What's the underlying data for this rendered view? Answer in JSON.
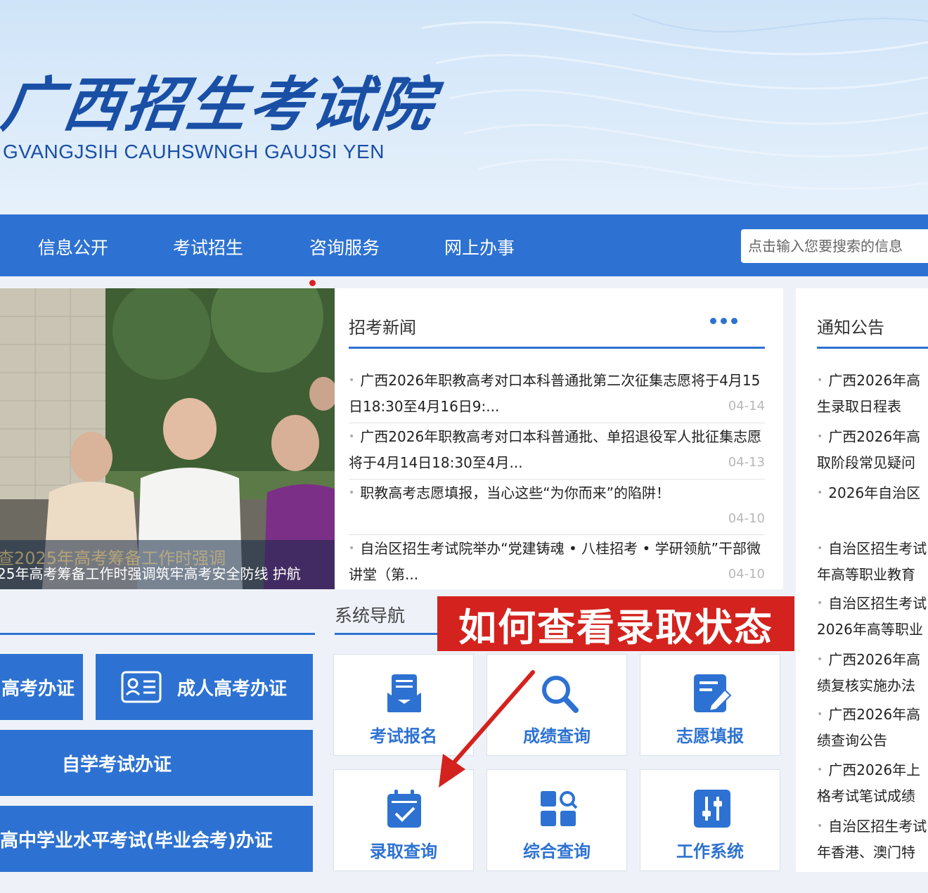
{
  "header": {
    "logo_cn": "广西招生考试院",
    "logo_en": "GVANGJSIH CAUHSWNGH GAUJSI YEN"
  },
  "nav": {
    "items": [
      "信息公开",
      "考试招生",
      "咨询服务",
      "网上办事"
    ],
    "search_placeholder": "点击输入您要搜索的信息"
  },
  "photo": {
    "caption_overlay": "查2025年高考筹备工作时强调",
    "caption": "25年高考筹备工作时强调筑牢高考安全防线 护航"
  },
  "news": {
    "title": "招考新闻",
    "items": [
      {
        "text": "广西2026年职教高考对口本科普通批第二次征集志愿将于4月15日18:30至4月16日9:...",
        "date": "04-14"
      },
      {
        "text": "广西2026年职教高考对口本科普通批、单招退役军人批征集志愿将于4月14日18:30至4月...",
        "date": "04-13"
      },
      {
        "text": "职教高考志愿填报，当心这些“为你而来”的陷阱！",
        "date": "04-10"
      },
      {
        "text": "自治区招生考试院举办“党建铸魂 • 八桂招考 • 学研领航”干部微讲堂（第...",
        "date": "04-10"
      }
    ]
  },
  "notice": {
    "title": "通知公告",
    "items": [
      {
        "line1": "广西2026年高",
        "line2": "生录取日程表"
      },
      {
        "line1": "广西2026年高",
        "line2": "取阶段常见疑问"
      },
      {
        "line1": "2026年自治区",
        "line2": ""
      },
      {
        "line1": "自治区招生考试",
        "line2": "年高等职业教育"
      },
      {
        "line1": "自治区招生考试",
        "line2": "2026年高等职业"
      },
      {
        "line1": "广西2026年高",
        "line2": "绩复核实施办法"
      },
      {
        "line1": "广西2026年高",
        "line2": "绩查询公告"
      },
      {
        "line1": "广西2026年上",
        "line2": "格考试笔试成绩"
      },
      {
        "line1": "自治区招生考试",
        "line2": "年香港、澳门特"
      }
    ]
  },
  "left_buttons": {
    "gaokao": "高考办证",
    "adult": "成人高考办证",
    "self_study": "自学考试办证",
    "xueye": "高中学业水平考试(毕业会考)办证"
  },
  "system_nav": {
    "title": "系统导航",
    "tiles": [
      "考试报名",
      "成绩查询",
      "志愿填报",
      "录取查询",
      "综合查询",
      "工作系统"
    ]
  },
  "annotation": {
    "label": "如何查看录取状态",
    "color": "#d4221e"
  },
  "colors": {
    "primary": "#2d72d2",
    "banner": "#dcebfa",
    "accent_red": "#d4221e"
  }
}
